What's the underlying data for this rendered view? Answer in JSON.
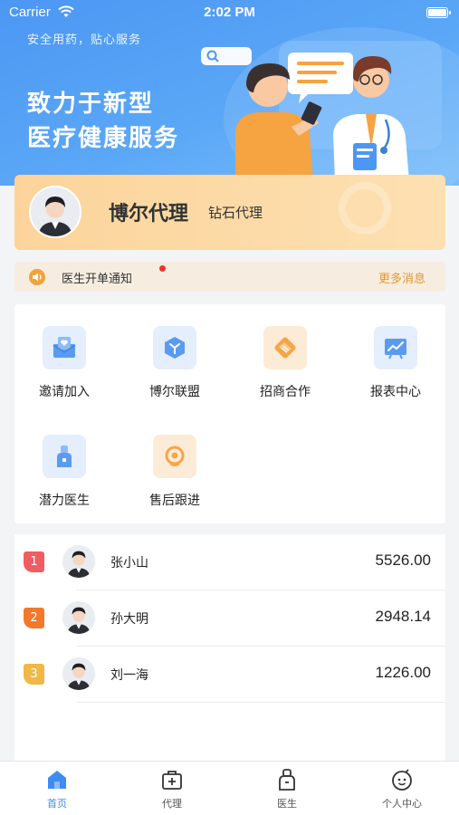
{
  "status_bar": {
    "carrier": "Carrier",
    "time": "2:02 PM"
  },
  "banner": {
    "slogan": "安全用药，贴心服务",
    "headline_line1": "致力于新型",
    "headline_line2": "医疗健康服务"
  },
  "profile": {
    "name": "博尔代理",
    "level": "钻石代理"
  },
  "notice": {
    "text": "医生开单通知",
    "more": "更多消息"
  },
  "features": [
    {
      "label": "邀请加入",
      "icon": "invite-icon"
    },
    {
      "label": "博尔联盟",
      "icon": "alliance-icon"
    },
    {
      "label": "招商合作",
      "icon": "cooperation-icon"
    },
    {
      "label": "报表中心",
      "icon": "report-icon"
    },
    {
      "label": "潜力医生",
      "icon": "doctor-icon"
    },
    {
      "label": "售后跟进",
      "icon": "after-sales-icon"
    }
  ],
  "ranking": [
    {
      "rank": "1",
      "name": "张小山",
      "amount": "5526.00",
      "color": "#ee5d62"
    },
    {
      "rank": "2",
      "name": "孙大明",
      "amount": "2948.14",
      "color": "#f0792c"
    },
    {
      "rank": "3",
      "name": "刘一海",
      "amount": "1226.00",
      "color": "#f0b847"
    }
  ],
  "tabs": [
    {
      "label": "首页",
      "icon": "home-icon"
    },
    {
      "label": "代理",
      "icon": "agent-icon"
    },
    {
      "label": "医生",
      "icon": "doctor-tab-icon"
    },
    {
      "label": "个人中心",
      "icon": "profile-icon"
    }
  ],
  "colors": {
    "accent": "#3e8cf0",
    "gold": "#fcd49b",
    "notice_bg": "#f6ede0"
  }
}
